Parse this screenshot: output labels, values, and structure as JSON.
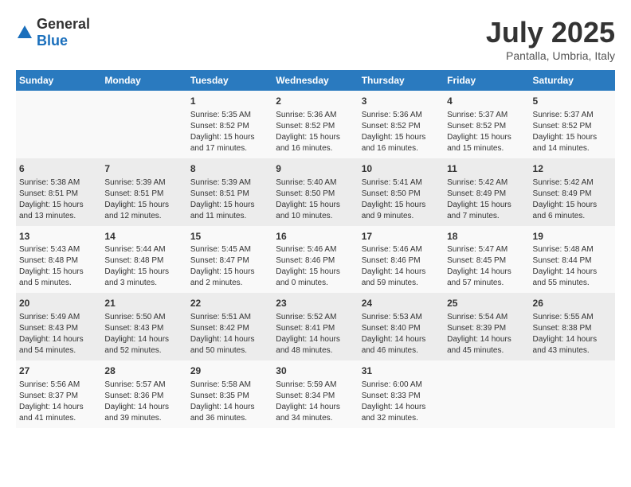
{
  "logo": {
    "general": "General",
    "blue": "Blue"
  },
  "header": {
    "month": "July 2025",
    "location": "Pantalla, Umbria, Italy"
  },
  "weekdays": [
    "Sunday",
    "Monday",
    "Tuesday",
    "Wednesday",
    "Thursday",
    "Friday",
    "Saturday"
  ],
  "weeks": [
    [
      {
        "day": "",
        "content": ""
      },
      {
        "day": "",
        "content": ""
      },
      {
        "day": "1",
        "content": "Sunrise: 5:35 AM\nSunset: 8:52 PM\nDaylight: 15 hours\nand 17 minutes."
      },
      {
        "day": "2",
        "content": "Sunrise: 5:36 AM\nSunset: 8:52 PM\nDaylight: 15 hours\nand 16 minutes."
      },
      {
        "day": "3",
        "content": "Sunrise: 5:36 AM\nSunset: 8:52 PM\nDaylight: 15 hours\nand 16 minutes."
      },
      {
        "day": "4",
        "content": "Sunrise: 5:37 AM\nSunset: 8:52 PM\nDaylight: 15 hours\nand 15 minutes."
      },
      {
        "day": "5",
        "content": "Sunrise: 5:37 AM\nSunset: 8:52 PM\nDaylight: 15 hours\nand 14 minutes."
      }
    ],
    [
      {
        "day": "6",
        "content": "Sunrise: 5:38 AM\nSunset: 8:51 PM\nDaylight: 15 hours\nand 13 minutes."
      },
      {
        "day": "7",
        "content": "Sunrise: 5:39 AM\nSunset: 8:51 PM\nDaylight: 15 hours\nand 12 minutes."
      },
      {
        "day": "8",
        "content": "Sunrise: 5:39 AM\nSunset: 8:51 PM\nDaylight: 15 hours\nand 11 minutes."
      },
      {
        "day": "9",
        "content": "Sunrise: 5:40 AM\nSunset: 8:50 PM\nDaylight: 15 hours\nand 10 minutes."
      },
      {
        "day": "10",
        "content": "Sunrise: 5:41 AM\nSunset: 8:50 PM\nDaylight: 15 hours\nand 9 minutes."
      },
      {
        "day": "11",
        "content": "Sunrise: 5:42 AM\nSunset: 8:49 PM\nDaylight: 15 hours\nand 7 minutes."
      },
      {
        "day": "12",
        "content": "Sunrise: 5:42 AM\nSunset: 8:49 PM\nDaylight: 15 hours\nand 6 minutes."
      }
    ],
    [
      {
        "day": "13",
        "content": "Sunrise: 5:43 AM\nSunset: 8:48 PM\nDaylight: 15 hours\nand 5 minutes."
      },
      {
        "day": "14",
        "content": "Sunrise: 5:44 AM\nSunset: 8:48 PM\nDaylight: 15 hours\nand 3 minutes."
      },
      {
        "day": "15",
        "content": "Sunrise: 5:45 AM\nSunset: 8:47 PM\nDaylight: 15 hours\nand 2 minutes."
      },
      {
        "day": "16",
        "content": "Sunrise: 5:46 AM\nSunset: 8:46 PM\nDaylight: 15 hours\nand 0 minutes."
      },
      {
        "day": "17",
        "content": "Sunrise: 5:46 AM\nSunset: 8:46 PM\nDaylight: 14 hours\nand 59 minutes."
      },
      {
        "day": "18",
        "content": "Sunrise: 5:47 AM\nSunset: 8:45 PM\nDaylight: 14 hours\nand 57 minutes."
      },
      {
        "day": "19",
        "content": "Sunrise: 5:48 AM\nSunset: 8:44 PM\nDaylight: 14 hours\nand 55 minutes."
      }
    ],
    [
      {
        "day": "20",
        "content": "Sunrise: 5:49 AM\nSunset: 8:43 PM\nDaylight: 14 hours\nand 54 minutes."
      },
      {
        "day": "21",
        "content": "Sunrise: 5:50 AM\nSunset: 8:43 PM\nDaylight: 14 hours\nand 52 minutes."
      },
      {
        "day": "22",
        "content": "Sunrise: 5:51 AM\nSunset: 8:42 PM\nDaylight: 14 hours\nand 50 minutes."
      },
      {
        "day": "23",
        "content": "Sunrise: 5:52 AM\nSunset: 8:41 PM\nDaylight: 14 hours\nand 48 minutes."
      },
      {
        "day": "24",
        "content": "Sunrise: 5:53 AM\nSunset: 8:40 PM\nDaylight: 14 hours\nand 46 minutes."
      },
      {
        "day": "25",
        "content": "Sunrise: 5:54 AM\nSunset: 8:39 PM\nDaylight: 14 hours\nand 45 minutes."
      },
      {
        "day": "26",
        "content": "Sunrise: 5:55 AM\nSunset: 8:38 PM\nDaylight: 14 hours\nand 43 minutes."
      }
    ],
    [
      {
        "day": "27",
        "content": "Sunrise: 5:56 AM\nSunset: 8:37 PM\nDaylight: 14 hours\nand 41 minutes."
      },
      {
        "day": "28",
        "content": "Sunrise: 5:57 AM\nSunset: 8:36 PM\nDaylight: 14 hours\nand 39 minutes."
      },
      {
        "day": "29",
        "content": "Sunrise: 5:58 AM\nSunset: 8:35 PM\nDaylight: 14 hours\nand 36 minutes."
      },
      {
        "day": "30",
        "content": "Sunrise: 5:59 AM\nSunset: 8:34 PM\nDaylight: 14 hours\nand 34 minutes."
      },
      {
        "day": "31",
        "content": "Sunrise: 6:00 AM\nSunset: 8:33 PM\nDaylight: 14 hours\nand 32 minutes."
      },
      {
        "day": "",
        "content": ""
      },
      {
        "day": "",
        "content": ""
      }
    ]
  ]
}
